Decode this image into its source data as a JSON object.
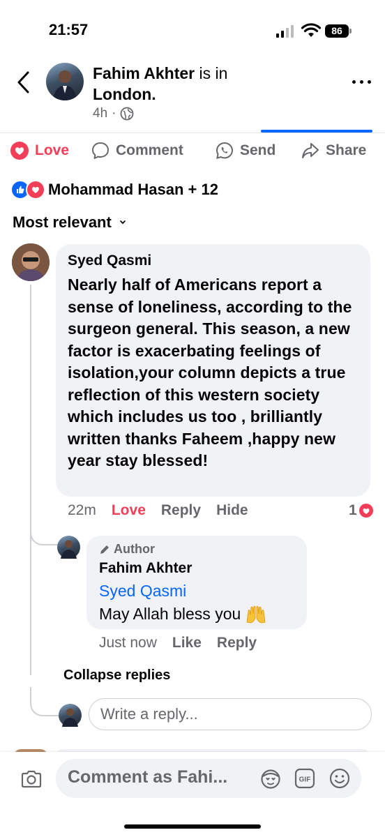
{
  "status": {
    "time": "21:57",
    "battery": "86"
  },
  "header": {
    "name": "Fahim Akhter",
    "is_in": "is in",
    "place": "London.",
    "age": "4h",
    "dot": "·"
  },
  "actions": {
    "love": "Love",
    "comment": "Comment",
    "send": "Send",
    "share": "Share"
  },
  "reactions": {
    "summary": "Mohammad Hasan + 12"
  },
  "sort": {
    "label": "Most relevant"
  },
  "comment": {
    "author": "Syed Qasmi",
    "text": "Nearly half of Americans report a sense of loneliness, according to the surgeon general. This season, a new factor is exacerbating feelings of isolation,your column depicts a true reflection of this western society which includes us too , brilliantly written thanks Faheem ,happy new year stay blessed!",
    "time": "22m",
    "love": "Love",
    "reply": "Reply",
    "hide": "Hide",
    "reaction_count": "1"
  },
  "reply": {
    "badge": "Author",
    "author": "Fahim Akhter",
    "tag": "Syed Qasmi",
    "text": "May Allah bless you",
    "time": "Just now",
    "like": "Like",
    "reply": "Reply"
  },
  "collapse": "Collapse replies",
  "write_reply": {
    "placeholder": "Write a reply..."
  },
  "composer": {
    "placeholder": "Comment as Fahi..."
  },
  "colors": {
    "accent": "#0866ff",
    "love": "#f33e58",
    "muted": "#65676b",
    "bubble": "#f0f2f5"
  }
}
